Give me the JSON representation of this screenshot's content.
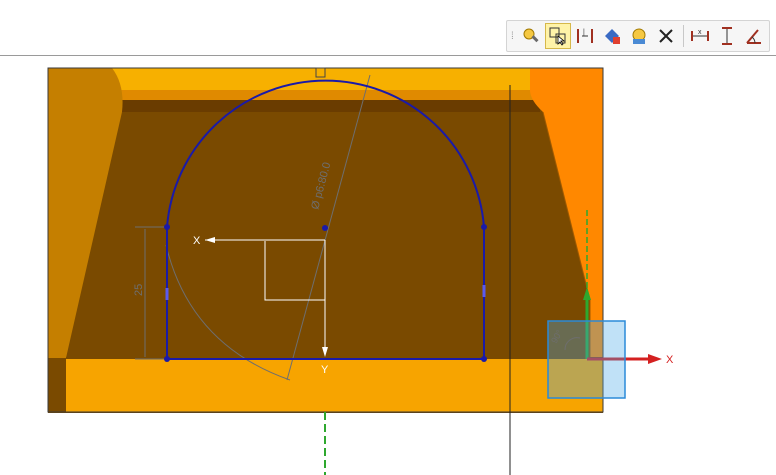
{
  "toolbar": {
    "buttons": [
      {
        "name": "sketch-find-icon",
        "glyph": "🔍"
      },
      {
        "name": "select-geometry-icon",
        "glyph": "⬚",
        "active": true
      },
      {
        "name": "auto-dimension-icon",
        "glyph": "⇹"
      },
      {
        "name": "relation-icon",
        "glyph": "◆"
      },
      {
        "name": "constraint-browser-icon",
        "glyph": "⚙"
      },
      {
        "name": "delete-icon",
        "glyph": "✕"
      },
      {
        "name": "horizontal-dimension-icon",
        "glyph": "↔"
      },
      {
        "name": "vertical-dimension-icon",
        "glyph": "↕"
      },
      {
        "name": "angular-dimension-icon",
        "glyph": "∠"
      }
    ]
  },
  "sketch": {
    "diameter_label": "Ø p6:80.0",
    "height_label": "25",
    "x_axis_label": "X",
    "y_axis_label": "Y",
    "datum_x_label": "X",
    "angle_label": "90°"
  },
  "colors": {
    "body_orange": "#f7a400",
    "inner_brown": "#7a4a00",
    "left_wall": "#c57f00",
    "right_wall": "#ff8800",
    "sketch_blue": "#1a1aa8",
    "dimension_gray": "#6e6e6e",
    "datum_green": "#2ea82e",
    "datum_red": "#d42020",
    "datum_plane": "#4aaae8"
  }
}
